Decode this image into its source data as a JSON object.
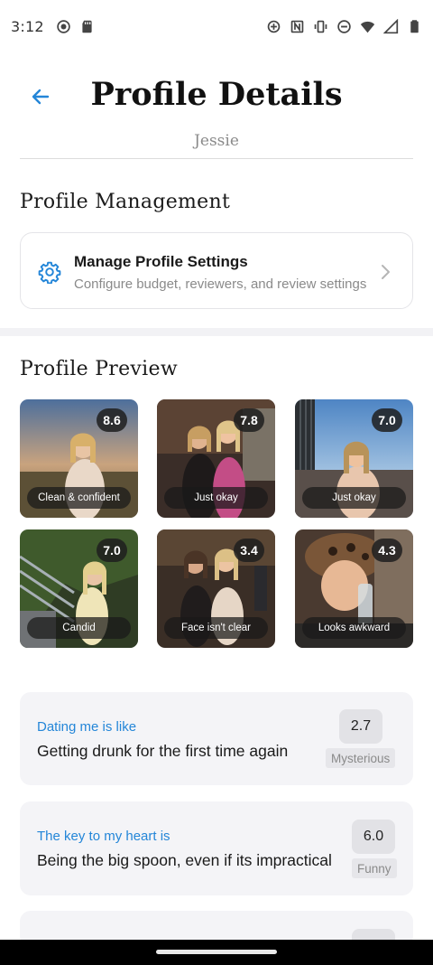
{
  "status_bar": {
    "time": "3:12",
    "icons_left": [
      "screen-record-icon",
      "sd-card-icon"
    ],
    "icons_right": [
      "data-saver-icon",
      "nfc-icon",
      "vibrate-icon",
      "do-not-disturb-icon",
      "wifi-icon",
      "cell-signal-icon",
      "battery-icon"
    ]
  },
  "header": {
    "title": "Profile Details",
    "subtitle": "Jessie",
    "back_icon": "arrow-left-icon"
  },
  "management": {
    "section_title": "Profile Management",
    "card_title": "Manage Profile Settings",
    "card_description": "Configure budget, reviewers, and review settings"
  },
  "preview": {
    "section_title": "Profile Preview",
    "photos": [
      {
        "score": "8.6",
        "caption": "Clean & confident"
      },
      {
        "score": "7.8",
        "caption": "Just okay"
      },
      {
        "score": "7.0",
        "caption": "Just okay"
      },
      {
        "score": "7.0",
        "caption": "Candid"
      },
      {
        "score": "3.4",
        "caption": "Face isn't clear"
      },
      {
        "score": "4.3",
        "caption": "Looks awkward"
      }
    ]
  },
  "prompts": [
    {
      "question": "Dating me is like",
      "answer": "Getting drunk for the first time again",
      "score": "2.7",
      "tag": "Mysterious"
    },
    {
      "question": "The key to my heart is",
      "answer": "Being the big spoon, even if its impractical",
      "score": "6.0",
      "tag": "Funny"
    }
  ],
  "colors": {
    "accent": "#2486d8",
    "card_bg": "#f4f4f7",
    "badge_bg": "#1e1e1e"
  }
}
